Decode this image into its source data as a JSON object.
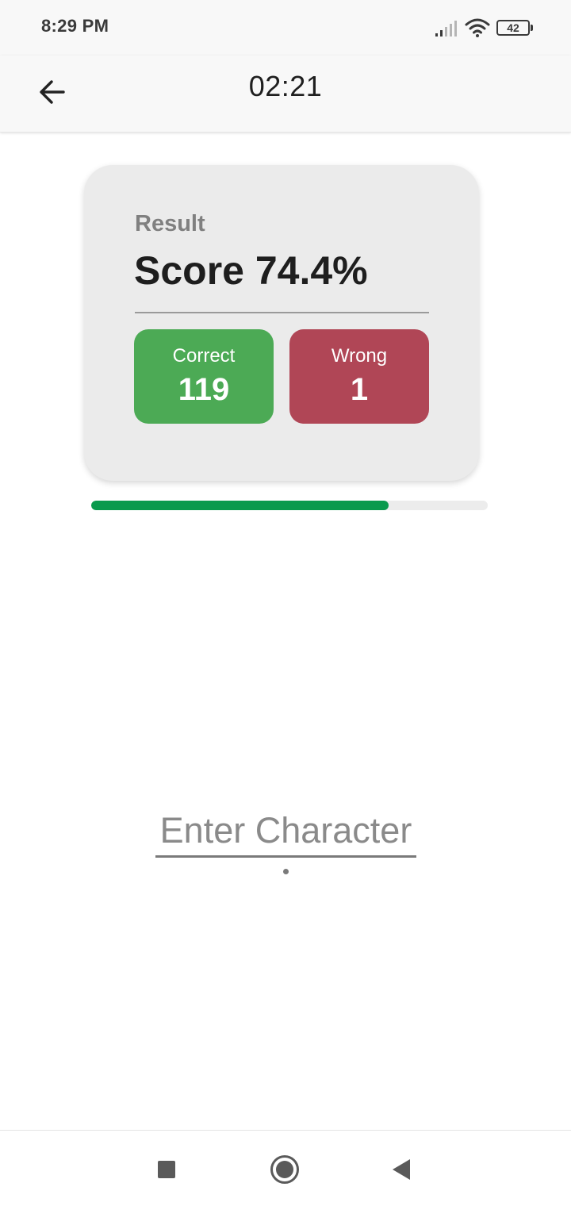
{
  "status_bar": {
    "time": "8:29 PM",
    "battery_level": "42",
    "icons": [
      "signal-icon",
      "wifi-icon",
      "battery-icon"
    ]
  },
  "app_bar": {
    "timer": "02:21",
    "back_icon": "arrow-left-icon"
  },
  "result_card": {
    "label": "Result",
    "score_text": "Score 74.4%",
    "correct": {
      "label": "Correct",
      "value": "119"
    },
    "wrong": {
      "label": "Wrong",
      "value": "1"
    }
  },
  "progress": {
    "fraction": 0.75,
    "fill_color": "#0a9a4d",
    "track_color": "#ececec"
  },
  "input": {
    "placeholder": "Enter Character",
    "value": ""
  },
  "nav_bar": {
    "icons": [
      "recent-apps-icon",
      "home-icon",
      "back-triangle-icon"
    ]
  },
  "colors": {
    "correct": "#4caa55",
    "wrong": "#b04656",
    "card_background": "#ebebeb"
  }
}
